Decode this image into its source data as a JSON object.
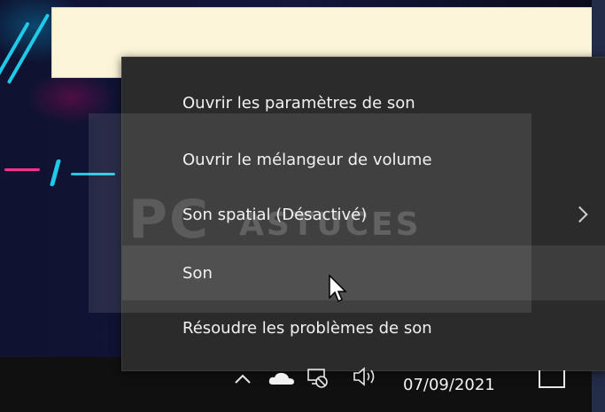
{
  "menu": {
    "items": [
      {
        "label": "Ouvrir les paramètres de son"
      },
      {
        "label": "Ouvrir le mélangeur de volume"
      },
      {
        "label": "Son spatial (Désactivé)"
      },
      {
        "label": "Son"
      },
      {
        "label": "Résoudre les problèmes de son"
      }
    ]
  },
  "taskbar": {
    "clock": "07/09/2021",
    "icons": [
      "chevron-up-icon",
      "onedrive-cloud-icon",
      "network-icon",
      "speaker-icon",
      "notification-icon"
    ]
  },
  "watermark": {
    "text": "PC",
    "sub": "ASTUCES"
  }
}
